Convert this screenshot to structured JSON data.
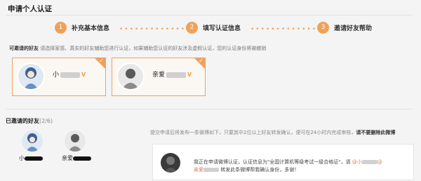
{
  "title": "申请个人认证",
  "steps": [
    {
      "num": "1",
      "label": "补充基本信息"
    },
    {
      "num": "2",
      "label": "填写认证信息"
    },
    {
      "num": "3",
      "label": "邀请好友帮助"
    }
  ],
  "hint": {
    "label": "可邀请的好友",
    "text": "请选择家感、真实的好友辅助您进行认证，如果辅助您认证的好友涉及虚假认证，您的认证身份将被撤销"
  },
  "cards": [
    {
      "name": "小",
      "badge": "V",
      "check": "✓"
    },
    {
      "name": "亲爱",
      "badge": "V",
      "check": "✓"
    }
  ],
  "invited": {
    "label": "已邀请的好友",
    "count": "(2/6)",
    "friends": [
      {
        "name": "小"
      },
      {
        "name": "亲爱"
      }
    ]
  },
  "submit_hint": {
    "text": "提交申请后将发布一条微博如下，只要其中2位以上好友转发确认，便可在24小时内完成审核",
    "warn": "请不要删除此微博"
  },
  "post": {
    "text1": "我正在申请微博认证，认证信息为\"全国计算机等级考试一级合格证\"，请",
    "mention1": "@小",
    "mention_suffix": "@",
    "mention2": "亲爱",
    "text2": "转发此条微博帮我确认身份，多谢！"
  },
  "colors": {
    "accent": "#f0a159",
    "card_border": "#eea15f"
  }
}
